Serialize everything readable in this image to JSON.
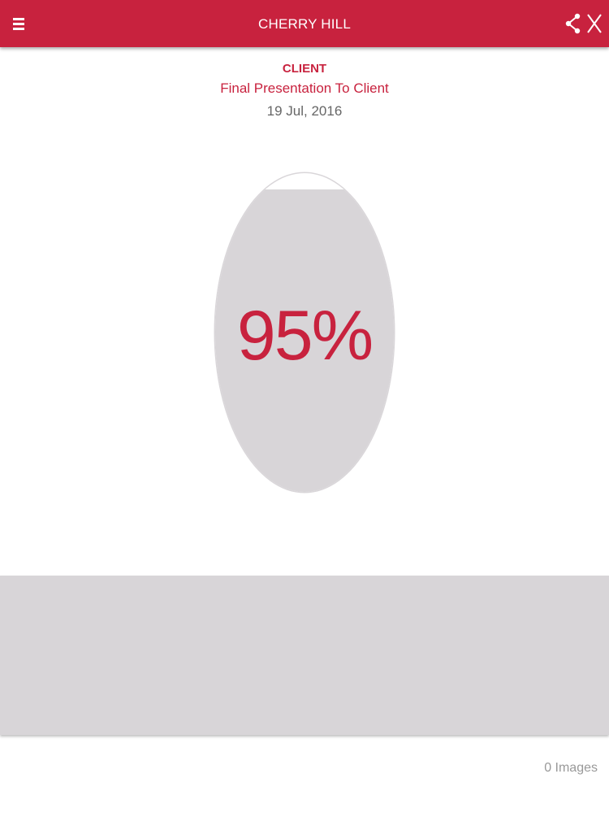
{
  "app_bar": {
    "title": "CHERRY HILL",
    "background_color": "#c8223e",
    "menu_icon": "hamburger-menu-icon",
    "share_icon": "share-icon",
    "close_icon": "close-icon"
  },
  "info": {
    "category": "CLIENT",
    "title": "Final Presentation To Client",
    "date": "19 Jul, 2016"
  },
  "progress": {
    "percent": 95,
    "label": "95%",
    "accent_color": "#c8223e",
    "fill_color": "#d8d5d8"
  },
  "images": {
    "count_label": "0 Images"
  }
}
